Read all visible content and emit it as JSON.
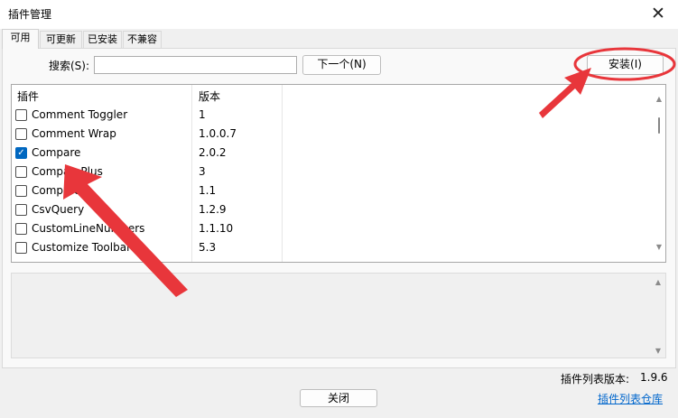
{
  "window": {
    "title": "插件管理",
    "close_label": "✕"
  },
  "tabs": [
    {
      "label": "可用",
      "active": true
    },
    {
      "label": "可更新",
      "active": false
    },
    {
      "label": "已安装",
      "active": false
    },
    {
      "label": "不兼容",
      "active": false
    }
  ],
  "search": {
    "label": "搜索(S):",
    "value": "",
    "next_button": "下一个(N)"
  },
  "install_button": "安装(I)",
  "grid": {
    "columns": [
      "插件",
      "版本"
    ],
    "rows": [
      {
        "name": "Comment Toggler",
        "version": "1",
        "checked": false
      },
      {
        "name": "Comment Wrap",
        "version": "1.0.0.7",
        "checked": false
      },
      {
        "name": "Compare",
        "version": "2.0.2",
        "checked": true
      },
      {
        "name": "ComparePlus",
        "version": "3",
        "checked": false
      },
      {
        "name": "Compare",
        "version": "1.1",
        "checked": false
      },
      {
        "name": "CsvQuery",
        "version": "1.2.9",
        "checked": false
      },
      {
        "name": "CustomLineNumbers",
        "version": "1.1.10",
        "checked": false
      },
      {
        "name": "Customize Toolbar",
        "version": "5.3",
        "checked": false
      }
    ]
  },
  "footer": {
    "list_version_label": "插件列表版本:",
    "list_version_value": "1.9.6",
    "repo_link": "插件列表仓库",
    "close_button": "关闭"
  },
  "annotation": {
    "arrow_color": "#e8363b",
    "highlight_color": "#e8363b"
  },
  "icons": {
    "check": "✓",
    "scroll_up": "▲",
    "scroll_down": "▼"
  }
}
